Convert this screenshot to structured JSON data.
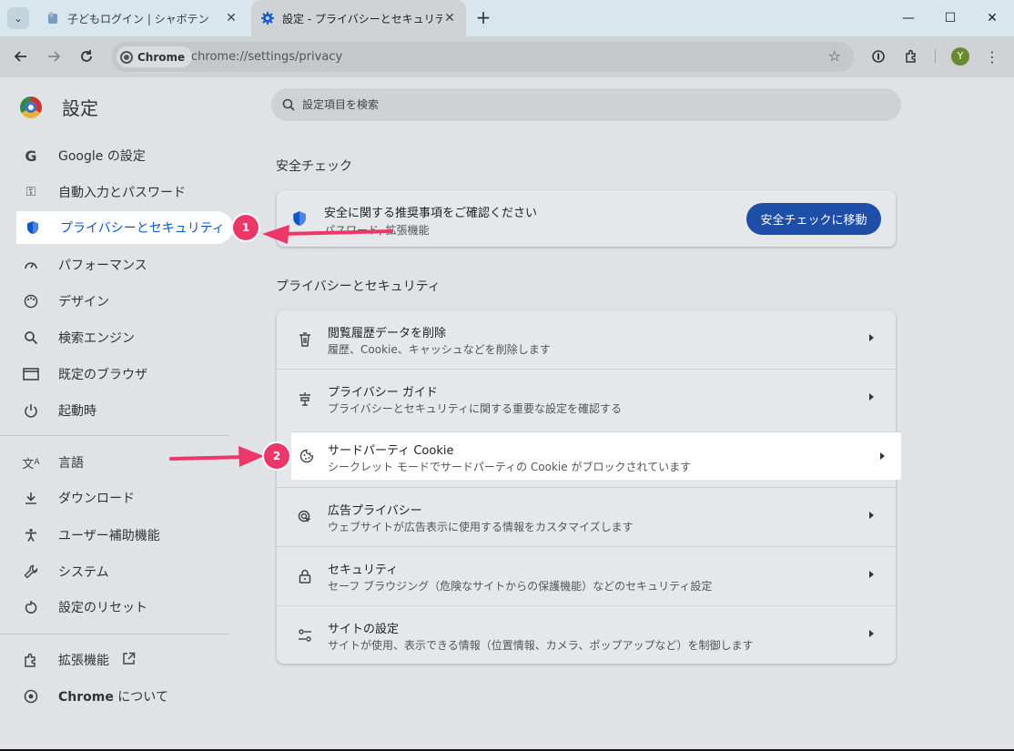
{
  "tabs": [
    {
      "title": "子どもログイン | シャボテン",
      "active": false
    },
    {
      "title": "設定 - プライバシーとセキュリティ",
      "active": true
    }
  ],
  "toolbar": {
    "chip_label": "Chrome",
    "url": "chrome://settings/privacy",
    "avatar_letter": "Y"
  },
  "settings": {
    "title": "設定",
    "search_placeholder": "設定項目を検索"
  },
  "nav": {
    "items": [
      {
        "label": "Google の設定",
        "icon": "google-icon"
      },
      {
        "label": "自動入力とパスワード",
        "icon": "key-icon"
      },
      {
        "label": "プライバシーとセキュリティ",
        "icon": "shield-icon",
        "selected": true
      },
      {
        "label": "パフォーマンス",
        "icon": "speedometer-icon"
      },
      {
        "label": "デザイン",
        "icon": "palette-icon"
      },
      {
        "label": "検索エンジン",
        "icon": "search-icon"
      },
      {
        "label": "既定のブラウザ",
        "icon": "browser-window-icon"
      },
      {
        "label": "起動時",
        "icon": "power-icon"
      },
      {
        "label": "言語",
        "icon": "translate-icon"
      },
      {
        "label": "ダウンロード",
        "icon": "download-icon"
      },
      {
        "label": "ユーザー補助機能",
        "icon": "accessibility-icon"
      },
      {
        "label": "システム",
        "icon": "wrench-icon"
      },
      {
        "label": "設定のリセット",
        "icon": "reset-icon"
      },
      {
        "label": "拡張機能",
        "icon": "puzzle-icon"
      },
      {
        "label_bold": "Chrome",
        "label_rest": " について",
        "icon": "chrome-icon"
      }
    ]
  },
  "safety_check": {
    "section_title": "安全チェック",
    "title": "安全に関する推奨事項をご確認ください",
    "subtitle": "パスワード, 拡張機能",
    "button": "安全チェックに移動"
  },
  "privacy": {
    "section_title": "プライバシーとセキュリティ",
    "rows": [
      {
        "title": "閲覧履歴データを削除",
        "subtitle": "履歴、Cookie、キャッシュなどを削除します",
        "icon": "trash-icon"
      },
      {
        "title": "プライバシー ガイド",
        "subtitle": "プライバシーとセキュリティに関する重要な設定を確認する",
        "icon": "privacy-guide-icon"
      },
      {
        "title": "サードパーティ Cookie",
        "subtitle": "シークレット モードでサードパーティの Cookie がブロックされています",
        "icon": "cookie-icon",
        "highlighted": true
      },
      {
        "title": "広告プライバシー",
        "subtitle": "ウェブサイトが広告表示に使用する情報をカスタマイズします",
        "icon": "ad-privacy-icon"
      },
      {
        "title": "セキュリティ",
        "subtitle": "セーフ ブラウジング（危険なサイトからの保護機能）などのセキュリティ設定",
        "icon": "lock-icon"
      },
      {
        "title": "サイトの設定",
        "subtitle": "サイトが使用、表示できる情報（位置情報、カメラ、ポップアップなど）を制御します",
        "icon": "sliders-icon"
      }
    ]
  },
  "annotations": [
    {
      "number": "1"
    },
    {
      "number": "2"
    }
  ],
  "colors": {
    "accent": "#0b57d0",
    "button": "#1d4fa8",
    "annotation": "#ee3769"
  }
}
